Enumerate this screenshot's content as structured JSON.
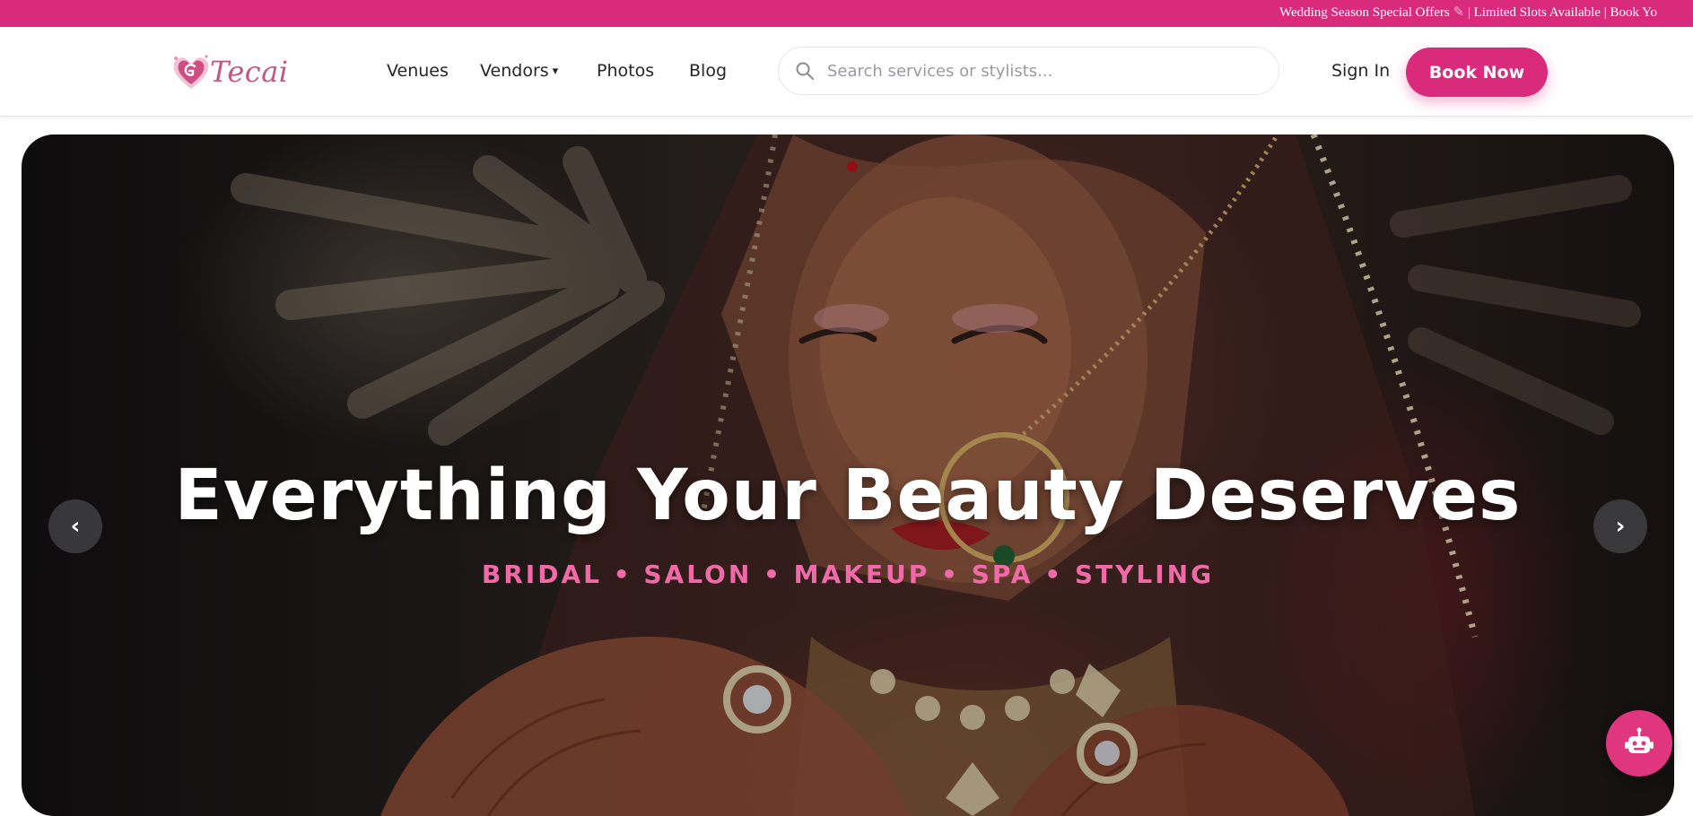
{
  "announcement": {
    "text": "Wedding Season Special Offers",
    "text_after": " | Limited Slots Available | Book Yo"
  },
  "nav": {
    "logo_text": "Tecai",
    "links": [
      "Venues",
      "Vendors",
      "Photos",
      "Blog"
    ],
    "vendors_caret": "▾",
    "search_placeholder": "Search services or stylists...",
    "sign_in": "Sign In",
    "book_now": "Book Now"
  },
  "hero": {
    "title": "Everything Your Beauty Deserves",
    "subtitle": "BRIDAL • SALON • MAKEUP • SPA • STYLING",
    "prev_arrow": "‹",
    "next_arrow": "›"
  },
  "colors": {
    "brand_pink": "#d92a7c",
    "subtitle_pink": "#f06aa8",
    "text_dark": "#262626"
  },
  "icons": {
    "search": "search-icon",
    "chatbot": "robot-icon",
    "logo": "heart-logo-icon"
  }
}
